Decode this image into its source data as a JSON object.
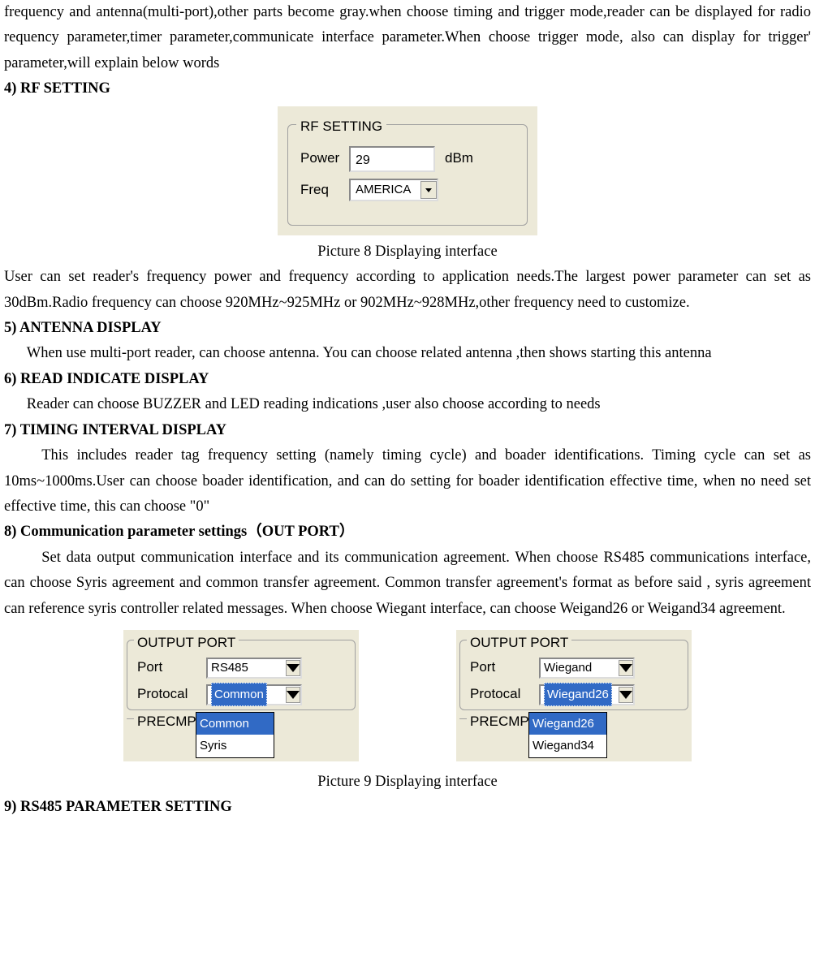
{
  "intro": "frequency and antenna(multi-port),other parts become gray.when choose timing and trigger mode,reader can be displayed for radio requency parameter,timer parameter,communicate interface parameter.When choose trigger mode, also can display for trigger' parameter,will explain below words",
  "s4": {
    "heading": "4)  RF SETTING",
    "fig": {
      "groupTitle": "RF SETTING",
      "powerLabel": "Power",
      "powerValue": "29",
      "powerUnit": "dBm",
      "freqLabel": "Freq",
      "freqValue": "AMERICA"
    },
    "caption": "Picture 8 Displaying interface",
    "body": "User can set reader's frequency power and frequency according to application needs.The largest power parameter can set as 30dBm.Radio frequency can choose 920MHz~925MHz  or 902MHz~928MHz,other frequency need to customize."
  },
  "s5": {
    "heading": "5)   ANTENNA DISPLAY",
    "body": "When use multi-port reader, can choose antenna. You can choose related antenna ,then shows starting this antenna"
  },
  "s6": {
    "heading": "6)   READ INDICATE DISPLAY",
    "body": "Reader can choose BUZZER and LED reading indications ,user also choose according to needs"
  },
  "s7": {
    "heading": "7)   TIMING INTERVAL DISPLAY",
    "body": "This includes reader tag frequency setting (namely timing cycle) and boader identifications. Timing cycle can set as 10ms~1000ms.User can choose boader identification, and can do setting for boader identification effective time, when no need set effective time, this can choose \"0\""
  },
  "s8": {
    "heading": "8)  Communication parameter settings（OUT PORT）",
    "body": "Set data output communication interface and its communication agreement. When choose RS485 communications interface, can choose Syris agreement and common transfer agreement. Common transfer agreement's format as before said , syris agreement can reference syris controller related messages. When choose Wiegant interface, can choose Weigand26 or Weigand34 agreement.",
    "fig1": {
      "groupTitle": "OUTPUT PORT",
      "portLabel": "Port",
      "portValue": "RS485",
      "protoLabel": "Protocal",
      "protoValue": "Common",
      "precmpLabel": "PRECMP",
      "options": [
        "Common",
        "Syris"
      ]
    },
    "fig2": {
      "groupTitle": "OUTPUT PORT",
      "portLabel": "Port",
      "portValue": "Wiegand",
      "protoLabel": "Protocal",
      "protoValue": "Wiegand26",
      "precmpLabel": "PRECMP",
      "options": [
        "Wiegand26",
        "Wiegand34"
      ]
    },
    "caption": "Picture 9 Displaying interface"
  },
  "s9": {
    "heading": "9)  RS485 PARAMETER SETTING"
  }
}
